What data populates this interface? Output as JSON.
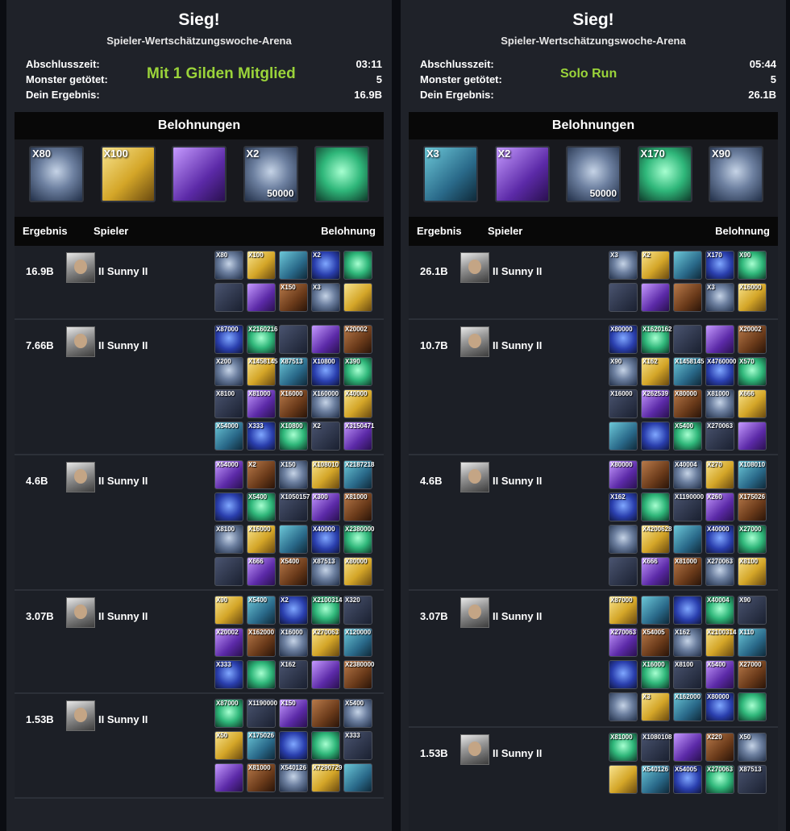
{
  "left": {
    "title": "Sieg!",
    "subtitle": "Spieler-Wertschätzungswoche-Arena",
    "overlay": "Mit 1 Gilden Mitglied",
    "stats": [
      {
        "label": "Abschlusszeit:",
        "value": "03:11"
      },
      {
        "label": "Monster getötet:",
        "value": "5"
      },
      {
        "label": "Dein Ergebnis:",
        "value": "16.9B"
      }
    ],
    "rewards_title": "Belohnungen",
    "rewards": [
      {
        "qty": "X80",
        "amount": "",
        "color": "c-silver"
      },
      {
        "qty": "X100",
        "amount": "",
        "color": "c-gold"
      },
      {
        "qty": "",
        "amount": "",
        "color": "c-purple"
      },
      {
        "qty": "X2",
        "amount": "50000",
        "color": "c-silver"
      },
      {
        "qty": "",
        "amount": "",
        "color": "c-green"
      }
    ],
    "headers": {
      "score": "Ergebnis",
      "player": "Spieler",
      "reward": "Belohnung"
    },
    "rows": [
      {
        "score": "16.9B",
        "player": "II Sunny II",
        "items": [
          "X80",
          "X100",
          "",
          "X2",
          "",
          "",
          "",
          "X150",
          "X3",
          ""
        ]
      },
      {
        "score": "7.66B",
        "player": "II Sunny II",
        "items": [
          "X87000",
          "X2160216",
          "",
          "",
          "X20002",
          "X200",
          "X1458145",
          "X87513",
          "X10800",
          "X390",
          "X8100",
          "X81000",
          "X16000",
          "X160000",
          "X40000",
          "X54000",
          "X333",
          "X10800",
          "X2",
          "X3150471"
        ]
      },
      {
        "score": "4.6B",
        "player": "II Sunny II",
        "items": [
          "X54000",
          "X2",
          "X150",
          "X108010",
          "X2187218",
          "",
          "X5400",
          "X1050157",
          "X300",
          "X81000",
          "X8100",
          "X16000",
          "",
          "X40000",
          "X2380000",
          "",
          "X666",
          "X5400",
          "X87513",
          "X80000"
        ]
      },
      {
        "score": "3.07B",
        "player": "II Sunny II",
        "items": [
          "X90",
          "X5400",
          "X2",
          "X2100314",
          "X320",
          "X20002",
          "X162000",
          "X16000",
          "X270063",
          "X120000",
          "X333",
          "",
          "X162",
          "",
          "X2380000"
        ]
      },
      {
        "score": "1.53B",
        "player": "II Sunny II",
        "items": [
          "X87000",
          "X1190000",
          "X150",
          "",
          "X5400",
          "X50",
          "X175026",
          "",
          "",
          "X333",
          "",
          "X81000",
          "X540126",
          "X7290729",
          ""
        ]
      }
    ]
  },
  "right": {
    "title": "Sieg!",
    "subtitle": "Spieler-Wertschätzungswoche-Arena",
    "overlay": "Solo Run",
    "stats": [
      {
        "label": "Abschlusszeit:",
        "value": "05:44"
      },
      {
        "label": "Monster getötet:",
        "value": "5"
      },
      {
        "label": "Dein Ergebnis:",
        "value": "26.1B"
      }
    ],
    "rewards_title": "Belohnungen",
    "rewards": [
      {
        "qty": "X3",
        "amount": "",
        "color": "c-teal"
      },
      {
        "qty": "X2",
        "amount": "",
        "color": "c-purple"
      },
      {
        "qty": "",
        "amount": "50000",
        "color": "c-silver"
      },
      {
        "qty": "X170",
        "amount": "",
        "color": "c-green"
      },
      {
        "qty": "X90",
        "amount": "",
        "color": "c-silver"
      }
    ],
    "headers": {
      "score": "Ergebnis",
      "player": "Spieler",
      "reward": "Belohnung"
    },
    "rows": [
      {
        "score": "26.1B",
        "player": "II Sunny II",
        "items": [
          "X3",
          "X2",
          "",
          "X170",
          "X90",
          "",
          "",
          "",
          "X3",
          "X16000"
        ]
      },
      {
        "score": "10.7B",
        "player": "II Sunny II",
        "items": [
          "X80000",
          "X1620162",
          "",
          "",
          "X20002",
          "X90",
          "X162",
          "X1458145",
          "X4760000",
          "X570",
          "X16000",
          "X262539",
          "X80000",
          "X81000",
          "X666",
          "",
          "",
          "X5400",
          "X270063",
          ""
        ]
      },
      {
        "score": "4.6B",
        "player": "II Sunny II",
        "items": [
          "X80000",
          "",
          "X40004",
          "X270",
          "X108010",
          "X162",
          "",
          "X1190000",
          "X260",
          "X175026",
          "",
          "X4200628",
          "",
          "X40000",
          "X27000",
          "",
          "X666",
          "X81000",
          "X270063",
          "X8100"
        ]
      },
      {
        "score": "3.07B",
        "player": "II Sunny II",
        "items": [
          "X87000",
          "",
          "",
          "X40004",
          "X90",
          "X270063",
          "X54005",
          "X162",
          "X2100314",
          "X110",
          "",
          "X16000",
          "X8100",
          "X5400",
          "X27000",
          "",
          "X3",
          "X162000",
          "X80000",
          ""
        ]
      },
      {
        "score": "1.53B",
        "player": "II Sunny II",
        "items": [
          "X81000",
          "X1080108",
          "",
          "X220",
          "X50",
          "",
          "X540126",
          "X54005",
          "X270063",
          "X87513"
        ]
      }
    ]
  }
}
